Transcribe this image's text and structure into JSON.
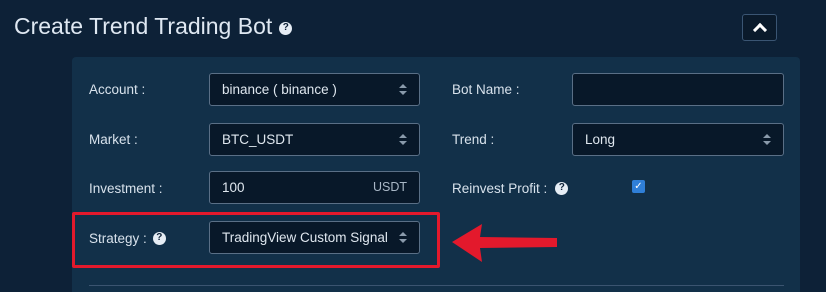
{
  "page": {
    "title": "Create Trend Trading Bot",
    "help_glyph": "?",
    "collapse_icon": "chevron-up-icon"
  },
  "form": {
    "account": {
      "label": "Account :",
      "value": "binance ( binance )"
    },
    "bot_name": {
      "label": "Bot Name :",
      "value": ""
    },
    "market": {
      "label": "Market :",
      "value": "BTC_USDT"
    },
    "trend": {
      "label": "Trend :",
      "value": "Long"
    },
    "investment": {
      "label": "Investment :",
      "value": "100",
      "unit": "USDT"
    },
    "reinvest_profit": {
      "label": "Reinvest Profit :",
      "checked": true,
      "check_glyph": "✓"
    },
    "strategy": {
      "label": "Strategy :",
      "value": "TradingView Custom Signal"
    }
  },
  "annotation": {
    "highlight_color": "#e3192c",
    "arrow_color": "#e3192c"
  },
  "colors": {
    "background": "#0d2137",
    "card": "#123049",
    "checkbox_accent": "#2f7fd8"
  }
}
